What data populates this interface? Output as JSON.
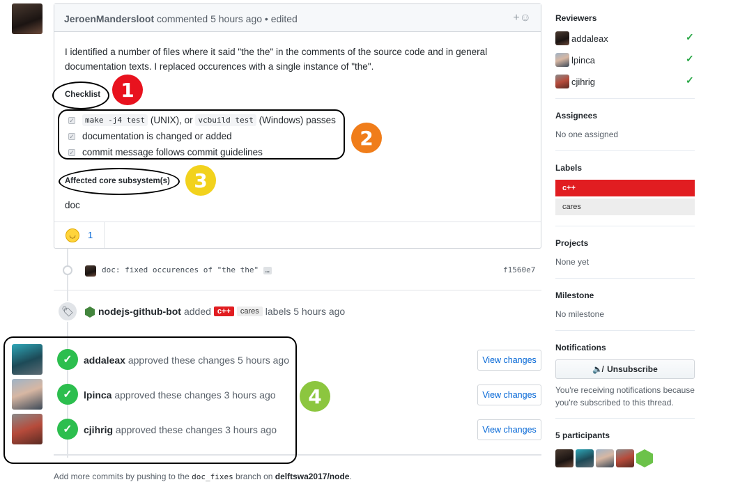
{
  "comment": {
    "author": "JeroenMandersloot",
    "meta": "commented 5 hours ago • edited",
    "add_reaction": "+☺",
    "body": "I identified a number of files where it said \"the the\" in the comments of the source code and in general documentation texts. I replaced occurences with a single instance of \"the\".",
    "checklist_heading": "Checklist",
    "tasks": [
      {
        "code1": "make -j4 test",
        "text1": " (UNIX), or ",
        "code2": "vcbuild test",
        "text2": " (Windows) passes"
      },
      {
        "text": "documentation is changed or added"
      },
      {
        "text": "commit message follows commit guidelines"
      }
    ],
    "subsystem_heading": "Affected core subsystem(s)",
    "subsystem_value": "doc",
    "reaction_count": "1"
  },
  "commit": {
    "message": "doc: fixed occurences of \"the the\"",
    "ellipsis": "…",
    "sha": "f1560e7"
  },
  "label_event": {
    "actor": "nodejs-github-bot",
    "verb": "added",
    "label1": "c++",
    "label2": "cares",
    "suffix": "labels 5 hours ago"
  },
  "approvals": [
    {
      "user": "addaleax",
      "text": "approved these changes 5 hours ago",
      "button": "View changes"
    },
    {
      "user": "lpinca",
      "text": "approved these changes 3 hours ago",
      "button": "View changes"
    },
    {
      "user": "cjihrig",
      "text": "approved these changes 3 hours ago",
      "button": "View changes"
    }
  ],
  "footer": {
    "prefix": "Add more commits by pushing to the ",
    "branch": "doc_fixes",
    "mid": " branch on ",
    "repo": "delftswa2017/node",
    "end": "."
  },
  "sidebar": {
    "reviewers_title": "Reviewers",
    "reviewers": [
      "addaleax",
      "lpinca",
      "cjihrig"
    ],
    "assignees_title": "Assignees",
    "assignees_value": "No one assigned",
    "labels_title": "Labels",
    "labels": [
      "c++",
      "cares"
    ],
    "projects_title": "Projects",
    "projects_value": "None yet",
    "milestone_title": "Milestone",
    "milestone_value": "No milestone",
    "notifications_title": "Notifications",
    "unsubscribe_label": "Unsubscribe",
    "notifications_text": "You're receiving notifications because you're subscribed to this thread.",
    "participants_title": "5 participants"
  },
  "annotations": [
    "1",
    "2",
    "3",
    "4"
  ],
  "colors": {
    "label_cpp": "#e11d21",
    "label_cares": "#ededed",
    "approve_green": "#2cbe4e",
    "badge1": "#e8121e",
    "badge2": "#f07d1a",
    "badge3": "#f2d21d",
    "badge4": "#8cc63f"
  }
}
